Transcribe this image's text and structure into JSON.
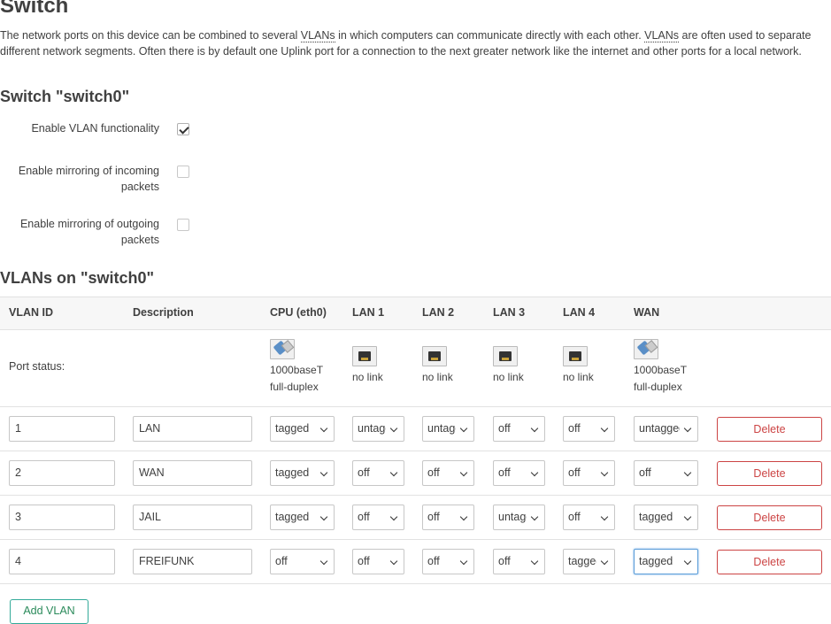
{
  "page": {
    "title": "Switch",
    "intro_parts": [
      "The network ports on this device can be combined to several ",
      "VLANs",
      " in which computers can communicate directly with each other. ",
      "VLANs",
      " are often used to separate different network segments. Often there is by default one Uplink port for a connection to the next greater network like the internet and other ports for a local network."
    ]
  },
  "switch": {
    "heading": "Switch \"switch0\"",
    "options": [
      {
        "label": "Enable VLAN functionality",
        "checked": true
      },
      {
        "label": "Enable mirroring of incoming packets",
        "checked": false
      },
      {
        "label": "Enable mirroring of outgoing packets",
        "checked": false
      }
    ]
  },
  "vlans": {
    "heading": "VLANs on \"switch0\"",
    "columns": [
      "VLAN ID",
      "Description",
      "CPU (eth0)",
      "LAN 1",
      "LAN 2",
      "LAN 3",
      "LAN 4",
      "WAN"
    ],
    "status_label": "Port status:",
    "port_status": [
      {
        "icon": "ethernet-link-icon",
        "lines": [
          "1000baseT",
          "full-duplex"
        ]
      },
      {
        "icon": "ethernet-nolink-icon",
        "lines": [
          "no link"
        ]
      },
      {
        "icon": "ethernet-nolink-icon",
        "lines": [
          "no link"
        ]
      },
      {
        "icon": "ethernet-nolink-icon",
        "lines": [
          "no link"
        ]
      },
      {
        "icon": "ethernet-nolink-icon",
        "lines": [
          "no link"
        ]
      },
      {
        "icon": "ethernet-link-icon",
        "lines": [
          "1000baseT",
          "full-duplex"
        ]
      }
    ],
    "rows": [
      {
        "id": "1",
        "description": "LAN",
        "ports": [
          "tagged",
          "untagged",
          "untagged",
          "off",
          "off",
          "untagged"
        ]
      },
      {
        "id": "2",
        "description": "WAN",
        "ports": [
          "tagged",
          "off",
          "off",
          "off",
          "off",
          "off"
        ]
      },
      {
        "id": "3",
        "description": "JAIL",
        "ports": [
          "tagged",
          "off",
          "off",
          "untagged",
          "off",
          "tagged"
        ]
      },
      {
        "id": "4",
        "description": "FREIFUNK",
        "ports": [
          "off",
          "off",
          "off",
          "off",
          "tagged",
          "tagged"
        ]
      }
    ],
    "delete_label": "Delete",
    "add_label": "Add VLAN"
  },
  "colors": {
    "delete": "#cc4444",
    "add": "#33aa77",
    "focus": "#5b9dd9"
  }
}
